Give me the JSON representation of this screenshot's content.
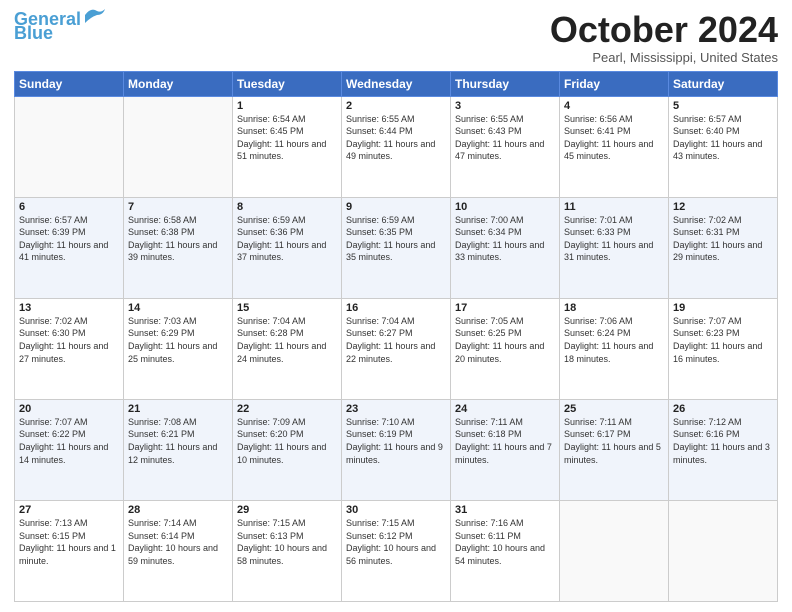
{
  "header": {
    "logo_line1": "General",
    "logo_line2": "Blue",
    "month_title": "October 2024",
    "subtitle": "Pearl, Mississippi, United States"
  },
  "days_of_week": [
    "Sunday",
    "Monday",
    "Tuesday",
    "Wednesday",
    "Thursday",
    "Friday",
    "Saturday"
  ],
  "weeks": [
    [
      {
        "day": "",
        "info": ""
      },
      {
        "day": "",
        "info": ""
      },
      {
        "day": "1",
        "info": "Sunrise: 6:54 AM\nSunset: 6:45 PM\nDaylight: 11 hours and 51 minutes."
      },
      {
        "day": "2",
        "info": "Sunrise: 6:55 AM\nSunset: 6:44 PM\nDaylight: 11 hours and 49 minutes."
      },
      {
        "day": "3",
        "info": "Sunrise: 6:55 AM\nSunset: 6:43 PM\nDaylight: 11 hours and 47 minutes."
      },
      {
        "day": "4",
        "info": "Sunrise: 6:56 AM\nSunset: 6:41 PM\nDaylight: 11 hours and 45 minutes."
      },
      {
        "day": "5",
        "info": "Sunrise: 6:57 AM\nSunset: 6:40 PM\nDaylight: 11 hours and 43 minutes."
      }
    ],
    [
      {
        "day": "6",
        "info": "Sunrise: 6:57 AM\nSunset: 6:39 PM\nDaylight: 11 hours and 41 minutes."
      },
      {
        "day": "7",
        "info": "Sunrise: 6:58 AM\nSunset: 6:38 PM\nDaylight: 11 hours and 39 minutes."
      },
      {
        "day": "8",
        "info": "Sunrise: 6:59 AM\nSunset: 6:36 PM\nDaylight: 11 hours and 37 minutes."
      },
      {
        "day": "9",
        "info": "Sunrise: 6:59 AM\nSunset: 6:35 PM\nDaylight: 11 hours and 35 minutes."
      },
      {
        "day": "10",
        "info": "Sunrise: 7:00 AM\nSunset: 6:34 PM\nDaylight: 11 hours and 33 minutes."
      },
      {
        "day": "11",
        "info": "Sunrise: 7:01 AM\nSunset: 6:33 PM\nDaylight: 11 hours and 31 minutes."
      },
      {
        "day": "12",
        "info": "Sunrise: 7:02 AM\nSunset: 6:31 PM\nDaylight: 11 hours and 29 minutes."
      }
    ],
    [
      {
        "day": "13",
        "info": "Sunrise: 7:02 AM\nSunset: 6:30 PM\nDaylight: 11 hours and 27 minutes."
      },
      {
        "day": "14",
        "info": "Sunrise: 7:03 AM\nSunset: 6:29 PM\nDaylight: 11 hours and 25 minutes."
      },
      {
        "day": "15",
        "info": "Sunrise: 7:04 AM\nSunset: 6:28 PM\nDaylight: 11 hours and 24 minutes."
      },
      {
        "day": "16",
        "info": "Sunrise: 7:04 AM\nSunset: 6:27 PM\nDaylight: 11 hours and 22 minutes."
      },
      {
        "day": "17",
        "info": "Sunrise: 7:05 AM\nSunset: 6:25 PM\nDaylight: 11 hours and 20 minutes."
      },
      {
        "day": "18",
        "info": "Sunrise: 7:06 AM\nSunset: 6:24 PM\nDaylight: 11 hours and 18 minutes."
      },
      {
        "day": "19",
        "info": "Sunrise: 7:07 AM\nSunset: 6:23 PM\nDaylight: 11 hours and 16 minutes."
      }
    ],
    [
      {
        "day": "20",
        "info": "Sunrise: 7:07 AM\nSunset: 6:22 PM\nDaylight: 11 hours and 14 minutes."
      },
      {
        "day": "21",
        "info": "Sunrise: 7:08 AM\nSunset: 6:21 PM\nDaylight: 11 hours and 12 minutes."
      },
      {
        "day": "22",
        "info": "Sunrise: 7:09 AM\nSunset: 6:20 PM\nDaylight: 11 hours and 10 minutes."
      },
      {
        "day": "23",
        "info": "Sunrise: 7:10 AM\nSunset: 6:19 PM\nDaylight: 11 hours and 9 minutes."
      },
      {
        "day": "24",
        "info": "Sunrise: 7:11 AM\nSunset: 6:18 PM\nDaylight: 11 hours and 7 minutes."
      },
      {
        "day": "25",
        "info": "Sunrise: 7:11 AM\nSunset: 6:17 PM\nDaylight: 11 hours and 5 minutes."
      },
      {
        "day": "26",
        "info": "Sunrise: 7:12 AM\nSunset: 6:16 PM\nDaylight: 11 hours and 3 minutes."
      }
    ],
    [
      {
        "day": "27",
        "info": "Sunrise: 7:13 AM\nSunset: 6:15 PM\nDaylight: 11 hours and 1 minute."
      },
      {
        "day": "28",
        "info": "Sunrise: 7:14 AM\nSunset: 6:14 PM\nDaylight: 10 hours and 59 minutes."
      },
      {
        "day": "29",
        "info": "Sunrise: 7:15 AM\nSunset: 6:13 PM\nDaylight: 10 hours and 58 minutes."
      },
      {
        "day": "30",
        "info": "Sunrise: 7:15 AM\nSunset: 6:12 PM\nDaylight: 10 hours and 56 minutes."
      },
      {
        "day": "31",
        "info": "Sunrise: 7:16 AM\nSunset: 6:11 PM\nDaylight: 10 hours and 54 minutes."
      },
      {
        "day": "",
        "info": ""
      },
      {
        "day": "",
        "info": ""
      }
    ]
  ]
}
